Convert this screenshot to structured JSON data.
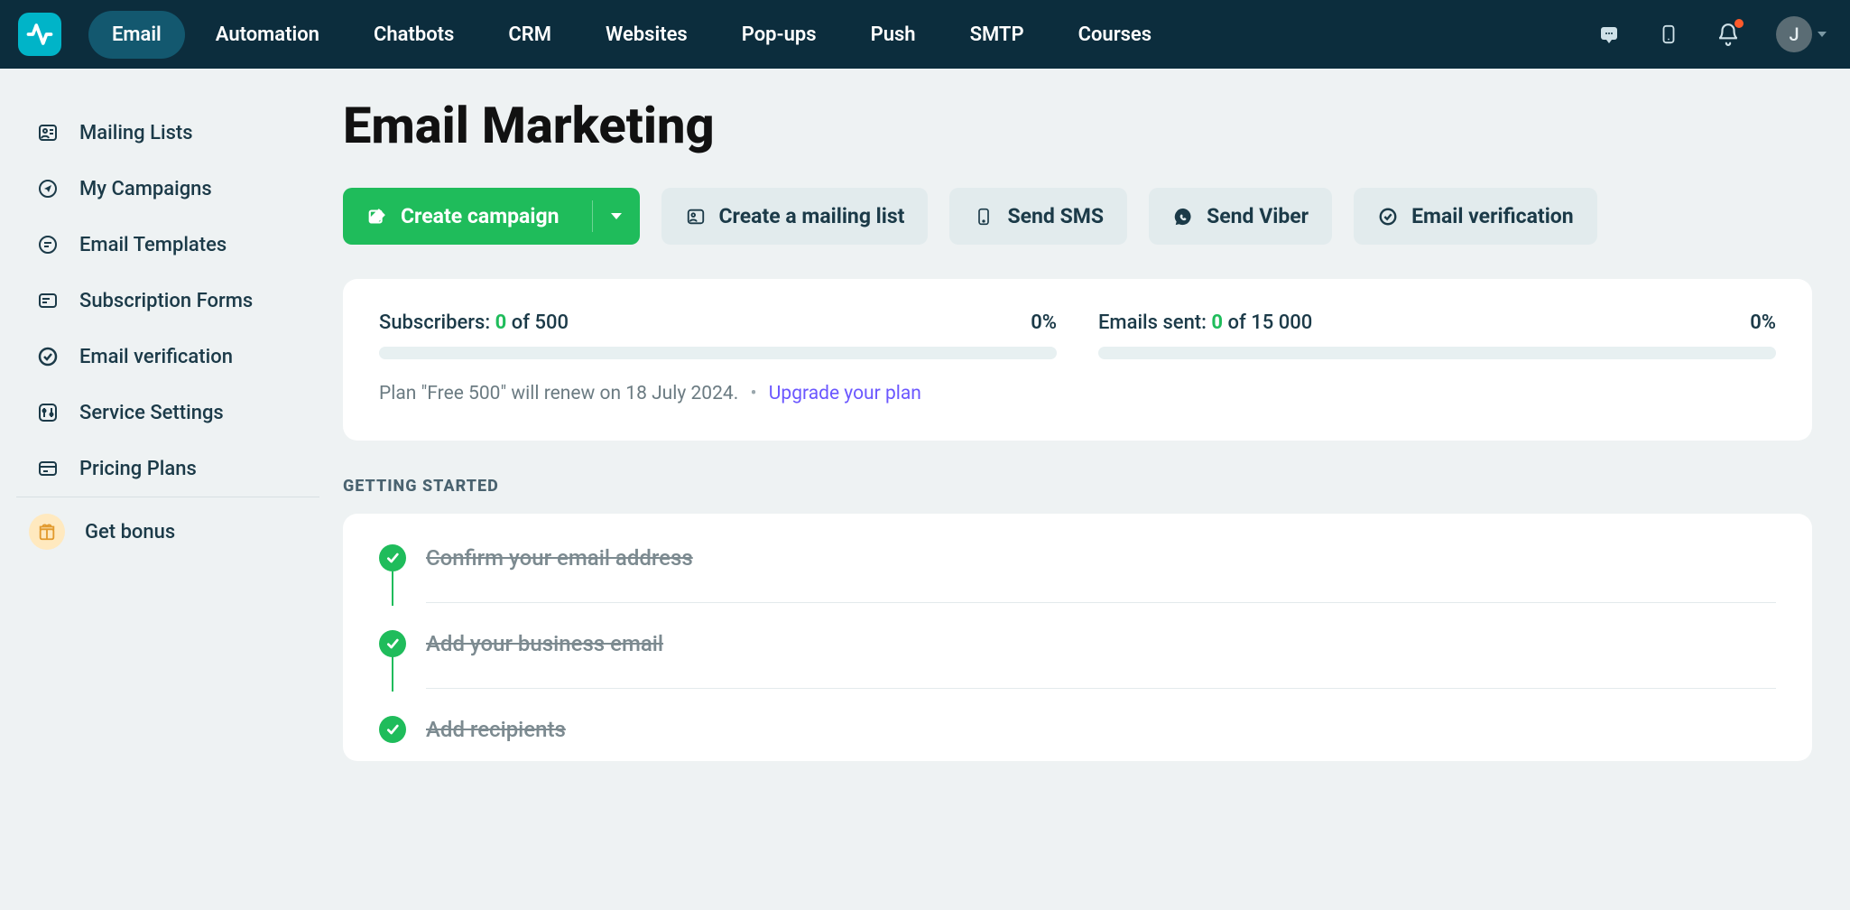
{
  "nav": {
    "items": [
      {
        "label": "Email",
        "active": true
      },
      {
        "label": "Automation"
      },
      {
        "label": "Chatbots"
      },
      {
        "label": "CRM"
      },
      {
        "label": "Websites"
      },
      {
        "label": "Pop-ups"
      },
      {
        "label": "Push"
      },
      {
        "label": "SMTP"
      },
      {
        "label": "Courses"
      }
    ],
    "avatar_initial": "J"
  },
  "sidebar": {
    "items": [
      {
        "label": "Mailing Lists",
        "icon": "contact-card-icon"
      },
      {
        "label": "My Campaigns",
        "icon": "send-icon"
      },
      {
        "label": "Email Templates",
        "icon": "template-icon"
      },
      {
        "label": "Subscription Forms",
        "icon": "form-icon"
      },
      {
        "label": "Email verification",
        "icon": "verify-check-icon"
      },
      {
        "label": "Service Settings",
        "icon": "settings-sliders-icon"
      },
      {
        "label": "Pricing Plans",
        "icon": "pricing-icon"
      }
    ],
    "bonus_label": "Get bonus"
  },
  "page": {
    "title": "Email Marketing",
    "actions": {
      "create_campaign": "Create campaign",
      "create_mailing_list": "Create a mailing list",
      "send_sms": "Send SMS",
      "send_viber": "Send Viber",
      "email_verification": "Email verification"
    },
    "stats": {
      "subscribers": {
        "label_prefix": "Subscribers: ",
        "value": "0",
        "of": " of 500",
        "percent": "0%"
      },
      "emails_sent": {
        "label_prefix": "Emails sent: ",
        "value": "0",
        "of": " of 15 000",
        "percent": "0%"
      },
      "plan_text": "Plan \"Free 500\" will renew on 18 July 2024.",
      "plan_sep": "•",
      "upgrade_label": "Upgrade your plan"
    },
    "getting_started": {
      "title": "GETTING STARTED",
      "items": [
        {
          "label": "Confirm your email address",
          "done": true
        },
        {
          "label": "Add your business email",
          "done": true
        },
        {
          "label": "Add recipients",
          "done": true
        }
      ]
    }
  },
  "colors": {
    "brand_teal": "#00b4c8",
    "nav_bg": "#0c2d3d",
    "accent_green": "#1fbc5b",
    "link_purple": "#6b57ff"
  }
}
